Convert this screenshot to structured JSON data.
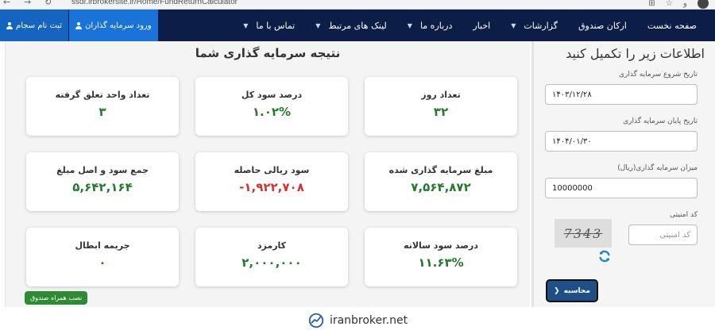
{
  "browser": {
    "url": "ssdf.irbrokersite.ir/Home/FundReturnCalculator",
    "extra_char": "و"
  },
  "nav": {
    "items": [
      {
        "label": "صفحه نخست",
        "dropdown": false
      },
      {
        "label": "ارکان صندوق",
        "dropdown": false
      },
      {
        "label": "گزارشات",
        "dropdown": true
      },
      {
        "label": "اخبار",
        "dropdown": false
      },
      {
        "label": "درباره ما",
        "dropdown": true
      },
      {
        "label": "لینک های مرتبط",
        "dropdown": true
      },
      {
        "label": "تماس با ما",
        "dropdown": true
      }
    ],
    "login_label": "ورود سرمایه گذاران",
    "signup_label": "ثبت نام سجام"
  },
  "results": {
    "title": "نتیجه سرمایه گذاری شما",
    "cards": [
      {
        "label": "تعداد روز",
        "value": "۳۲",
        "tone": "pos"
      },
      {
        "label": "درصد سود کل",
        "value": "۱.۰۲%",
        "tone": "pos"
      },
      {
        "label": "تعداد واحد تعلق گرفته",
        "value": "۳",
        "tone": "pos"
      },
      {
        "label": "مبلغ سرمایه گذاری شده",
        "value": "۷,۵۶۴,۸۷۲",
        "tone": "pos"
      },
      {
        "label": "سود ریالی حاصله",
        "value": "-۱,۹۲۲,۷۰۸",
        "tone": "neg"
      },
      {
        "label": "جمع سود و اصل مبلغ",
        "value": "۵,۶۴۲,۱۶۴",
        "tone": "pos"
      },
      {
        "label": "درصد سود سالانه",
        "value": "۱۱.۶۳%",
        "tone": "pos"
      },
      {
        "label": "کارمزد",
        "value": "۲,۰۰۰,۰۰۰",
        "tone": "pos"
      },
      {
        "label": "جریمه ابطال",
        "value": "۰",
        "tone": "pos"
      }
    ],
    "badge": "نصب همراه صندوق"
  },
  "form": {
    "title": "اطلاعات زیر را تکمیل کنید",
    "start_label": "تاریخ شروع سرمایه گذاری",
    "start_value": "۱۴۰۳/۱۲/۲۸",
    "end_label": "تاریخ پایان سرمایه گذاری",
    "end_value": "۱۴۰۴/۰۱/۳۰",
    "amount_label": "میزان سرمایه گذاری(ریال)",
    "amount_value": "10000000",
    "captcha_label": "کد امنیتی",
    "captcha_placeholder": "کد امنیتی",
    "captcha_text": "7343",
    "submit_label": "محاسبه"
  },
  "footer": {
    "brand": "iranbroker.net"
  },
  "colors": {
    "navbar": "#0c1d48",
    "positive": "#237a2c",
    "negative": "#d93030",
    "button": "#1f4f86",
    "badge": "#2e8b34"
  }
}
